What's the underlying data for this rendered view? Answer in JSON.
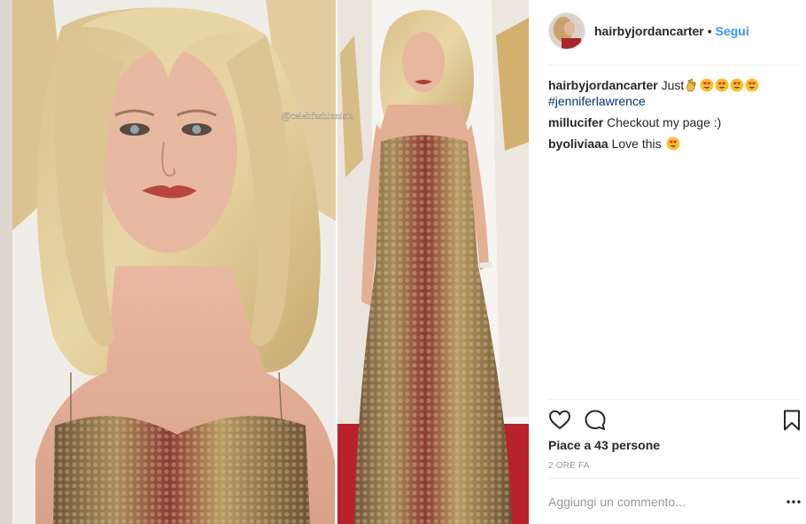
{
  "post": {
    "watermark": "@celebfashionista"
  },
  "header": {
    "username": "hairbyjordancarter",
    "separator": "•",
    "follow_label": "Segui"
  },
  "comments": [
    {
      "user": "hairbyjordancarter",
      "text": "Just",
      "tag": "#jenniferlawrence"
    },
    {
      "user": "millucifer",
      "text": "Checkout my page :)"
    },
    {
      "user": "byoliviaaa",
      "text": "Love this"
    }
  ],
  "icons": {
    "like": "heart-icon",
    "comment": "comment-icon",
    "save": "bookmark-icon",
    "more": "more-dots-icon",
    "emoji_ok": "ok-hand-emoji",
    "emoji_heart_eyes": "heart-eyes-emoji"
  },
  "likes": {
    "label": "Piace a 43 persone"
  },
  "timestamp": "2 ORE FA",
  "add_comment": {
    "placeholder": "Aggiungi un commento..."
  },
  "colors": {
    "link_blue": "#3897f0",
    "hashtag": "#003569",
    "muted": "#999999",
    "carpet_red": "#b8222a"
  }
}
